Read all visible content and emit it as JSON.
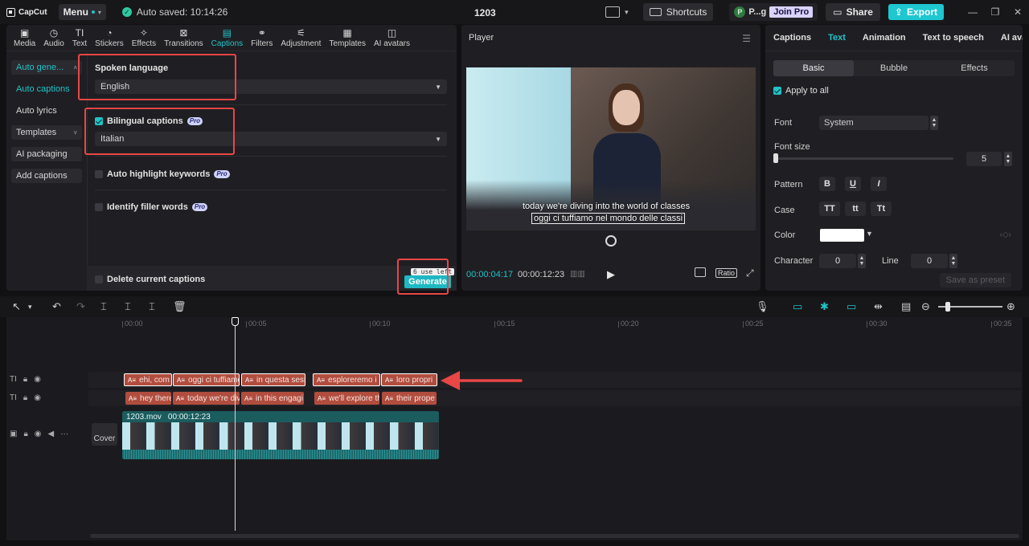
{
  "app": {
    "logo": "CapCut",
    "menu_label": "Menu",
    "autosave_text": "Auto saved: 10:14:26",
    "project_title": "1203",
    "shortcuts_label": "Shortcuts",
    "user_avatar_letter": "P",
    "user_name": "P...g",
    "join_pro_label": "Join Pro",
    "share_label": "Share",
    "export_label": "Export"
  },
  "tooltabs": [
    {
      "label": "Media",
      "icon": "media-icon"
    },
    {
      "label": "Audio",
      "icon": "audio-icon"
    },
    {
      "label": "Text",
      "icon": "text-icon"
    },
    {
      "label": "Stickers",
      "icon": "stickers-icon"
    },
    {
      "label": "Effects",
      "icon": "effects-icon"
    },
    {
      "label": "Transitions",
      "icon": "transitions-icon"
    },
    {
      "label": "Captions",
      "icon": "captions-icon",
      "active": true
    },
    {
      "label": "Filters",
      "icon": "filters-icon"
    },
    {
      "label": "Adjustment",
      "icon": "adjustment-icon"
    },
    {
      "label": "Templates",
      "icon": "templates-icon"
    },
    {
      "label": "AI avatars",
      "icon": "ai-avatars-icon"
    }
  ],
  "leftnav": {
    "auto_generate": "Auto gene...",
    "auto_captions": "Auto captions",
    "auto_lyrics": "Auto lyrics",
    "templates": "Templates",
    "ai_packaging": "AI packaging",
    "add_captions": "Add captions"
  },
  "captions_form": {
    "spoken_language_label": "Spoken language",
    "spoken_language_value": "English",
    "bilingual_label": "Bilingual captions",
    "bilingual_checked": true,
    "bilingual_value": "Italian",
    "auto_highlight_label": "Auto highlight keywords",
    "filler_words_label": "Identify filler words",
    "pro_badge": "Pro",
    "delete_label": "Delete current captions",
    "uses_left": "6 use left",
    "generate_label": "Generate"
  },
  "player": {
    "title": "Player",
    "caption_en": "today we're diving into the world of classes",
    "caption_it": "oggi ci tuffiamo nel mondo delle classi",
    "time_current": "00:00:04:17",
    "time_total": "00:00:12:23",
    "ratio_label": "Ratio"
  },
  "props": {
    "tabs": [
      "Captions",
      "Text",
      "Animation",
      "Text to speech",
      "AI ava"
    ],
    "active_tab": "Text",
    "style_tabs": [
      "Basic",
      "Bubble",
      "Effects"
    ],
    "apply_to_all": "Apply to all",
    "font_label": "Font",
    "font_value": "System",
    "font_size_label": "Font size",
    "font_size_value": "5",
    "pattern_label": "Pattern",
    "pattern_buttons": [
      "B",
      "U",
      "I"
    ],
    "case_label": "Case",
    "case_buttons": [
      "TT",
      "tt",
      "Tt"
    ],
    "color_label": "Color",
    "color_value": "#ffffff",
    "character_label": "Character",
    "character_value": "0",
    "line_label": "Line",
    "line_value": "0",
    "save_preset": "Save as preset"
  },
  "timeline": {
    "ruler": [
      "00:00",
      "00:05",
      "00:10",
      "00:15",
      "00:20",
      "00:25",
      "00:30",
      "00:35"
    ],
    "italian_clips": [
      "ehi, com",
      "oggi ci tuffiamo",
      "in questa sess",
      "esploreremo i",
      "loro propri"
    ],
    "english_clips": [
      "hey there",
      "today we're div",
      "in this engagi",
      "we'll explore th",
      "their prope"
    ],
    "video_name": "1203.mov",
    "video_duration": "00:00:12:23",
    "cover_label": "Cover"
  },
  "colors": {
    "accent": "#20c3c7",
    "highlight_red": "#e94646",
    "caption_clip": "#b14d3e",
    "video_clip": "#1d6a6c"
  }
}
